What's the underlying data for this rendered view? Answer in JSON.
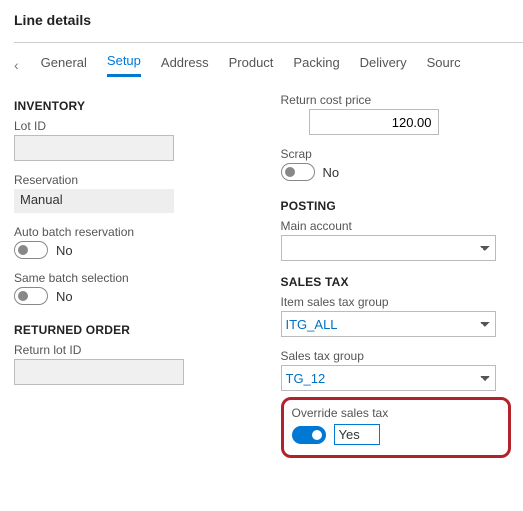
{
  "title": "Line details",
  "tabs": {
    "items": [
      "General",
      "Setup",
      "Address",
      "Product",
      "Packing",
      "Delivery",
      "Sourc"
    ],
    "active_index": 1
  },
  "left": {
    "inventory": {
      "heading": "INVENTORY",
      "lot_id_label": "Lot ID",
      "lot_id_value": "",
      "reservation_label": "Reservation",
      "reservation_value": "Manual",
      "auto_batch_label": "Auto batch reservation",
      "auto_batch_on": false,
      "auto_batch_text": "No",
      "same_batch_label": "Same batch selection",
      "same_batch_on": false,
      "same_batch_text": "No"
    },
    "returned": {
      "heading": "RETURNED ORDER",
      "return_lot_label": "Return lot ID",
      "return_lot_value": ""
    }
  },
  "right": {
    "return_cost": {
      "label": "Return cost price",
      "value": "120.00"
    },
    "scrap": {
      "label": "Scrap",
      "on": false,
      "text": "No"
    },
    "posting": {
      "heading": "POSTING",
      "main_account_label": "Main account",
      "main_account_value": ""
    },
    "sales_tax": {
      "heading": "SALES TAX",
      "item_group_label": "Item sales tax group",
      "item_group_value": "ITG_ALL",
      "group_label": "Sales tax group",
      "group_value": "TG_12",
      "override_label": "Override sales tax",
      "override_on": true,
      "override_text": "Yes"
    }
  }
}
